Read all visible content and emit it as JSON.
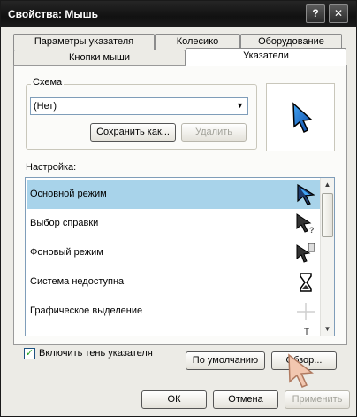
{
  "window": {
    "title": "Свойства: Мышь"
  },
  "titlebar_buttons": {
    "help": "?",
    "close": "✕"
  },
  "tabs_back": [
    "Параметры указателя",
    "Колесико",
    "Оборудование"
  ],
  "tabs_front": [
    "Кнопки мыши",
    "Указатели"
  ],
  "scheme": {
    "group_label": "Схема",
    "selected": "(Нет)",
    "save_as": "Сохранить как...",
    "delete": "Удалить"
  },
  "settings_label": "Настройка:",
  "list_items": [
    {
      "label": "Основной режим",
      "icon": "arrow-cursor-icon"
    },
    {
      "label": "Выбор справки",
      "icon": "help-cursor-icon"
    },
    {
      "label": "Фоновый режим",
      "icon": "working-cursor-icon"
    },
    {
      "label": "Система недоступна",
      "icon": "hourglass-icon"
    },
    {
      "label": "Графическое выделение",
      "icon": "crosshair-icon"
    }
  ],
  "shadow_checkbox": {
    "label": "Включить тень указателя",
    "checked": true
  },
  "buttons": {
    "default": "По умолчанию",
    "browse": "Обзор...",
    "ok": "ОК",
    "cancel": "Отмена",
    "apply": "Применить"
  },
  "colors": {
    "selection": "#a8d3ea",
    "titlebar": "#1a1a1a",
    "accent_cursor": "#1e88e5"
  }
}
